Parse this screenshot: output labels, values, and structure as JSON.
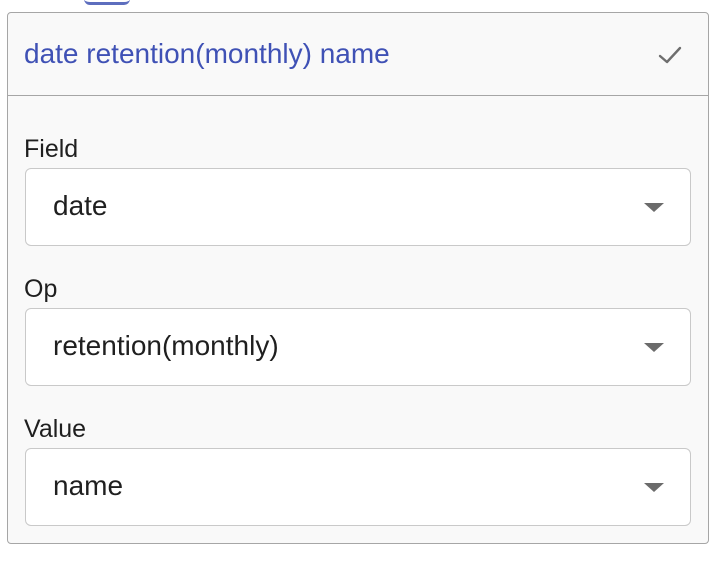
{
  "card": {
    "title": "date retention(monthly) name",
    "confirm_icon": "check-icon"
  },
  "fields": [
    {
      "label": "Field",
      "value": "date"
    },
    {
      "label": "Op",
      "value": "retention(monthly)"
    },
    {
      "label": "Value",
      "value": "name"
    }
  ],
  "colors": {
    "title": "#3f51b5",
    "border": "#a6a6a6",
    "card_background": "#f9f9f9"
  }
}
